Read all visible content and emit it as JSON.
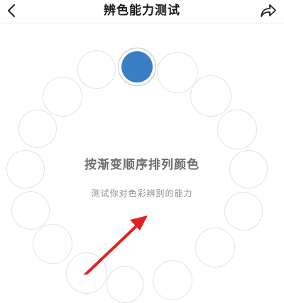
{
  "header": {
    "title": "辨色能力测试",
    "back_icon": "chevron-left-icon",
    "share_icon": "share-arrow-icon"
  },
  "main": {
    "title": "按渐变顺序排列颜色",
    "subtitle": "测试你对色彩辨别的能力",
    "selected_color": "#3a7ec6",
    "annotation_color": "#e02121"
  }
}
